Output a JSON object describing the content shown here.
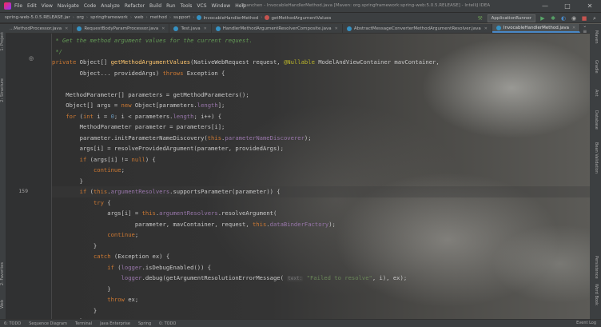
{
  "window": {
    "title": "Yuanchen - InvocableHandlerMethod.java [Maven: org.springframework:spring-web:5.0.5.RELEASE] - IntelliJ IDEA",
    "controls": [
      "—",
      "□",
      "✕"
    ]
  },
  "menu": [
    "File",
    "Edit",
    "View",
    "Navigate",
    "Code",
    "Analyze",
    "Refactor",
    "Build",
    "Run",
    "Tools",
    "VCS",
    "Window",
    "Help"
  ],
  "breadcrumbs": [
    {
      "label": "spring-web-5.0.5.RELEASE.jar",
      "kind": "jar"
    },
    {
      "label": "org",
      "kind": "pkg"
    },
    {
      "label": "springframework",
      "kind": "pkg"
    },
    {
      "label": "web",
      "kind": "pkg"
    },
    {
      "label": "method",
      "kind": "pkg"
    },
    {
      "label": "support",
      "kind": "pkg"
    },
    {
      "label": "InvocableHandlerMethod",
      "kind": "class"
    },
    {
      "label": "getMethodArgumentValues",
      "kind": "method"
    }
  ],
  "toolbar": {
    "run_config": "ApplicationRunner",
    "icons": [
      "hammer-icon",
      "run-icon",
      "debug-icon",
      "coverage-icon",
      "profile-icon",
      "stop-icon",
      "search-icon"
    ]
  },
  "tabs": [
    {
      "label": "...MethodProcessor.java",
      "active": false
    },
    {
      "label": "RequestBodyParamProcessor.java",
      "active": false
    },
    {
      "label": "Test.java",
      "active": false
    },
    {
      "label": "HandlerMethodArgumentResolverComposite.java",
      "active": false
    },
    {
      "label": "AbstractMessageConverterMethodArgumentResolver.java",
      "active": false
    },
    {
      "label": "InvocableHandlerMethod.java",
      "active": true
    }
  ],
  "left_tools": [
    "1: Project",
    "2: Structure",
    "2: Favorites",
    "Web"
  ],
  "right_tools": [
    "Maven",
    "Gradle",
    "Ant",
    "Database",
    "Bean Validation",
    "Persistence",
    "Word Book"
  ],
  "editor": {
    "highlighted_line_number": "159",
    "comment_line_1": " * Get the method argument values for the current request.",
    "comment_line_2": " */",
    "hint_text": "text:"
  },
  "status": {
    "items": [
      "6: TODO",
      "Sequence Diagram",
      "Terminal",
      "Java Enterprise",
      "Spring",
      "0: TODO"
    ],
    "event_log": "Event Log"
  },
  "colors": {
    "keyword": "#cc7832",
    "method": "#ffc66d",
    "field": "#9876aa",
    "comment": "#629755",
    "annotation": "#bbb529",
    "number": "#6897bb",
    "string": "#6a8759"
  }
}
